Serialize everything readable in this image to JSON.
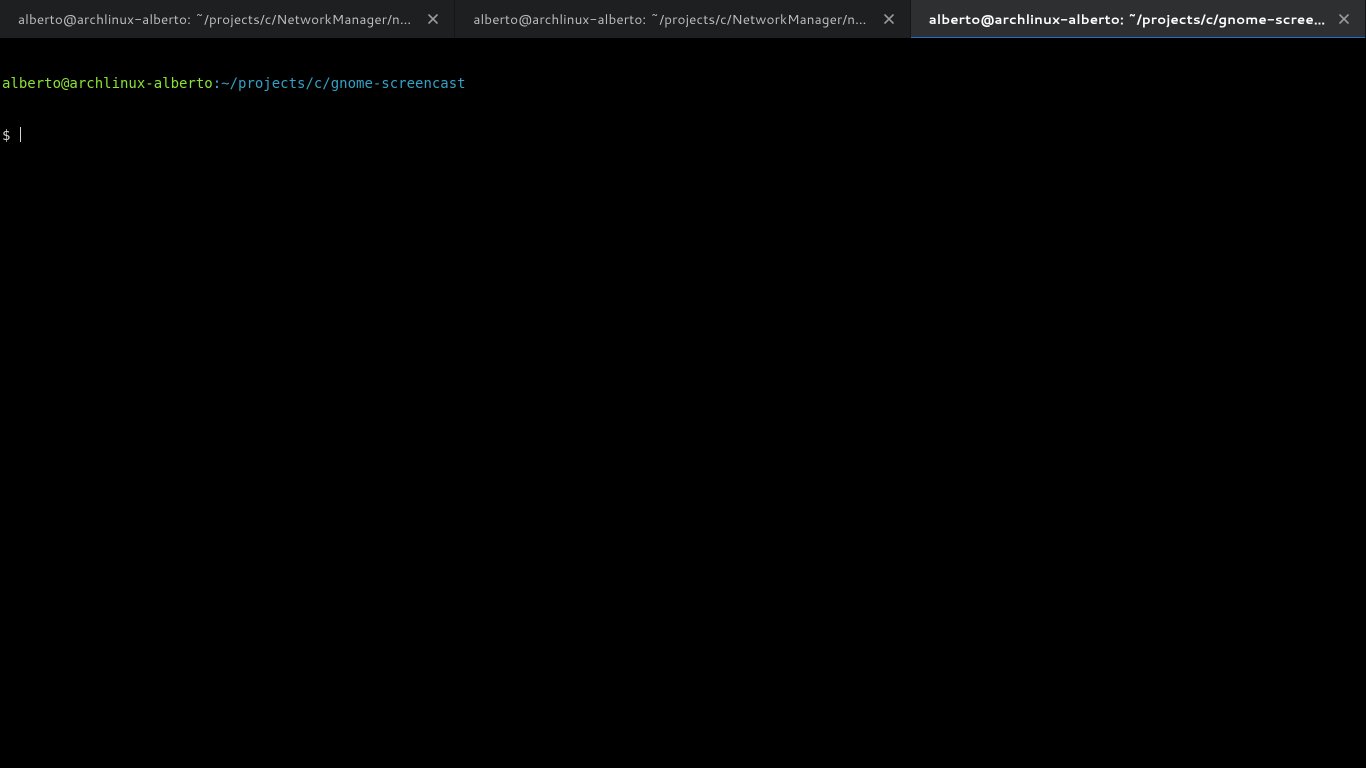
{
  "tabs": [
    {
      "title": "alberto@archlinux-alberto: ~/projects/c/NetworkManager/net…",
      "active": false
    },
    {
      "title": "alberto@archlinux-alberto: ~/projects/c/NetworkManager/net…",
      "active": false
    },
    {
      "title": "alberto@archlinux-alberto: ~/projects/c/gnome-screencast",
      "active": true
    }
  ],
  "prompt": {
    "userhost": "alberto@archlinux-alberto",
    "sep": ":",
    "path": "~/projects/c/gnome-screencast",
    "prompt_char": "$ "
  }
}
